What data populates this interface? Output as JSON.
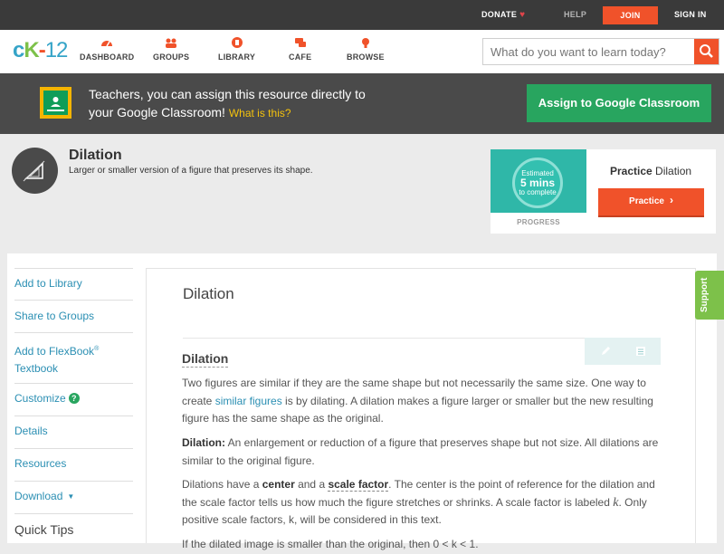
{
  "topbar": {
    "donate": "DONATE",
    "help": "HELP",
    "join": "JOIN",
    "signin": "SIGN IN"
  },
  "logo": {
    "c": "c",
    "k": "K",
    "dash": "-",
    "num": "12"
  },
  "nav": {
    "items": [
      {
        "label": "DASHBOARD",
        "icon": "dashboard-icon"
      },
      {
        "label": "GROUPS",
        "icon": "groups-icon"
      },
      {
        "label": "LIBRARY",
        "icon": "library-icon"
      },
      {
        "label": "CAFE",
        "icon": "cafe-icon"
      },
      {
        "label": "BROWSE",
        "icon": "browse-icon"
      }
    ],
    "search_placeholder": "What do you want to learn today?"
  },
  "banner": {
    "line1": "Teachers, you can assign this resource directly to",
    "line2": "your Google Classroom!",
    "what": "What is this?",
    "assign": "Assign to Google Classroom"
  },
  "concept": {
    "title": "Dilation",
    "description": "Larger or smaller version of a figure that preserves its shape."
  },
  "practice": {
    "estimated": "Estimated",
    "mins": "5 mins",
    "to_complete": "to complete",
    "progress_label": "PROGRESS",
    "title_bold": "Practice",
    "title_rest": "Dilation",
    "button": "Practice"
  },
  "sidebar": {
    "items": [
      "Add to Library",
      "Share to Groups",
      "Add to FlexBook",
      "Textbook",
      "Customize",
      "Details",
      "Resources",
      "Download"
    ],
    "registered": "®",
    "help_mark": "?",
    "caret": "▼",
    "quick_tips": "Quick Tips"
  },
  "article": {
    "title": "Dilation",
    "section": "Dilation",
    "p1_a": "Two figures are similar if they are the same shape but not necessarily the same size. One way to create ",
    "p1_link": "similar figures",
    "p1_b": " is by dilating. A dilation makes a figure larger or smaller but the new resulting figure has the same shape as the original.",
    "p2_bold": "Dilation:",
    "p2_rest": " An enlargement or reduction of a figure that preserves shape but not size. All dilations are similar to the original figure.",
    "p3_a": "Dilations have a ",
    "p3_center": "center",
    "p3_b": " and a ",
    "p3_scale": "scale factor",
    "p3_c": ". The center is the point of reference for the dilation and the scale factor tells us how much the figure stretches or shrinks. A scale factor is labeled ",
    "p3_k": "k",
    "p3_d": ". Only positive scale factors, k, will be considered in this text.",
    "p4": "If the dilated image is smaller than the original, then 0 < k < 1."
  },
  "support": "Support",
  "colors": {
    "accent_orange": "#f0522a",
    "google_green": "#28a55f",
    "link_blue": "#2b8fb3",
    "support_green": "#7dc14a"
  }
}
